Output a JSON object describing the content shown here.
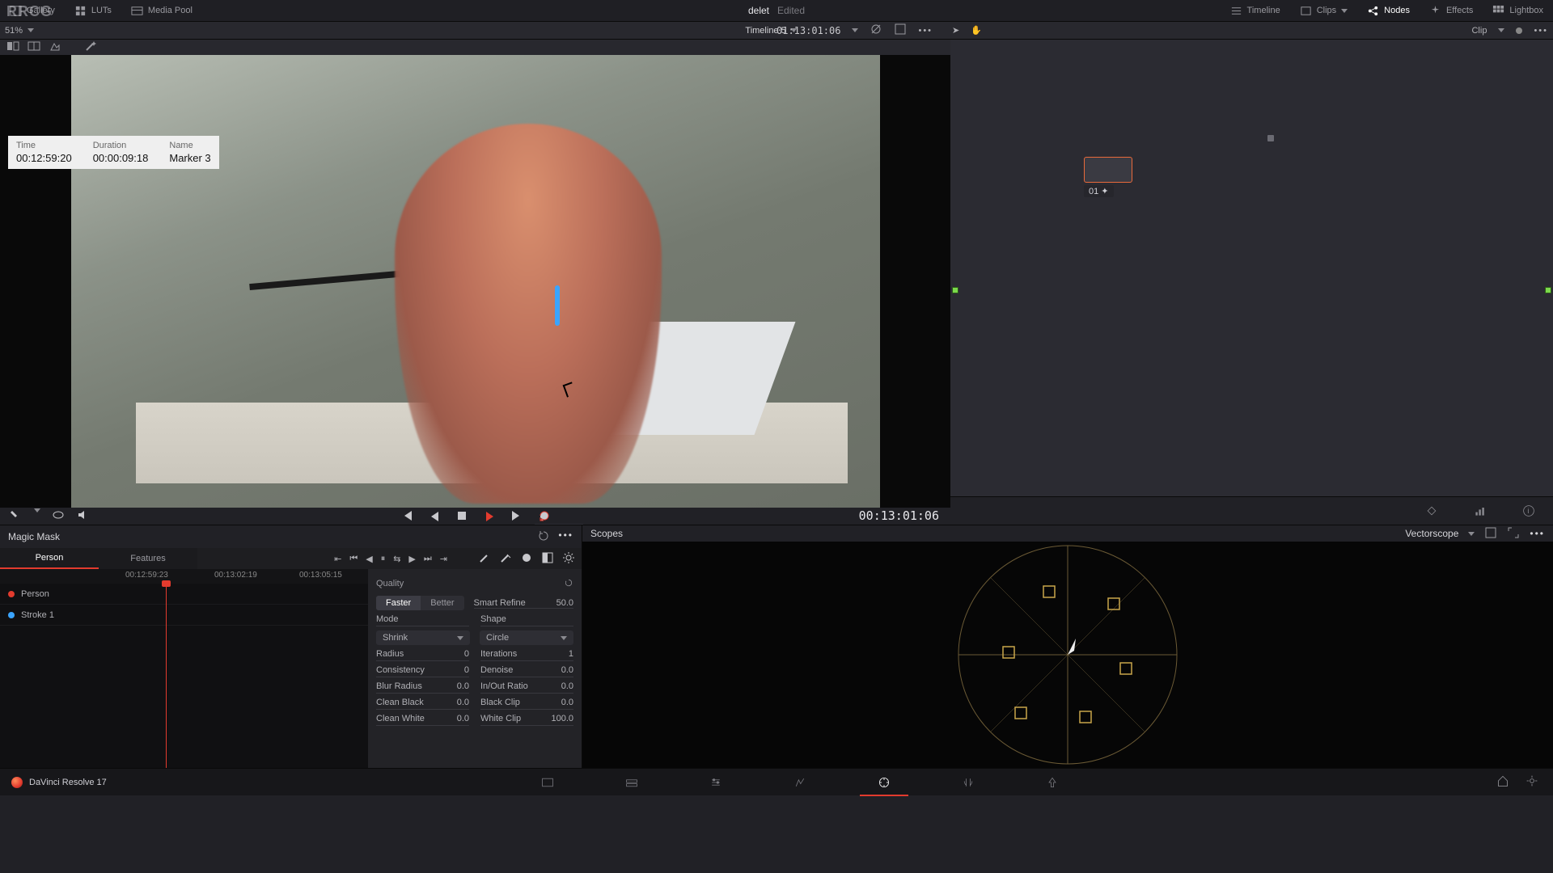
{
  "project": {
    "name": "delet",
    "status": "Edited"
  },
  "top_tabs": {
    "gallery": "Gallery",
    "luts": "LUTs",
    "media_pool": "Media Pool",
    "timeline": "Timeline",
    "clips": "Clips",
    "nodes": "Nodes",
    "effects": "Effects",
    "lightbox": "Lightbox"
  },
  "zoom": {
    "value": "51%"
  },
  "timeline_label": "Timeline 5",
  "viewer_tc_top": "01:13:01:06",
  "clip_mode": "Clip",
  "marker_tooltip": {
    "time_label": "Time",
    "time": "00:12:59:20",
    "duration_label": "Duration",
    "duration": "00:00:09:18",
    "name_label": "Name",
    "name": "Marker 3"
  },
  "transport_tc": "00:13:01:06",
  "node": {
    "label": "01"
  },
  "palette_names": [
    "camera-raw",
    "color-match",
    "color-wheels",
    "hdr-wheels",
    "rgb-mixer",
    "motion-effects",
    "curves",
    "warper",
    "qualifier",
    "window",
    "tracker",
    "magic-mask",
    "blur-sharpen",
    "key",
    "sizing",
    "3d"
  ],
  "magic_mask": {
    "title": "Magic Mask",
    "tabs": {
      "person": "Person",
      "features": "Features"
    },
    "rows": {
      "person": "Person",
      "stroke": "Stroke 1"
    },
    "ruler": [
      "00:12:59:23",
      "00:13:02:19",
      "00:13:05:15"
    ],
    "settings": {
      "quality_label": "Quality",
      "faster": "Faster",
      "better": "Better",
      "smart_refine_label": "Smart Refine",
      "smart_refine": "50.0",
      "mode_label": "Mode",
      "mode_value": "Shrink",
      "shape_label": "Shape",
      "shape_value": "Circle",
      "radius_label": "Radius",
      "radius": "0",
      "iterations_label": "Iterations",
      "iterations": "1",
      "consistency_label": "Consistency",
      "consistency": "0",
      "denoise_label": "Denoise",
      "denoise": "0.0",
      "blur_radius_label": "Blur Radius",
      "blur_radius": "0.0",
      "inout_label": "In/Out Ratio",
      "inout": "0.0",
      "clean_black_label": "Clean Black",
      "clean_black": "0.0",
      "black_clip_label": "Black Clip",
      "black_clip": "0.0",
      "clean_white_label": "Clean White",
      "clean_white": "0.0",
      "white_clip_label": "White Clip",
      "white_clip": "100.0"
    }
  },
  "scopes": {
    "title": "Scopes",
    "mode": "Vectorscope"
  },
  "app": {
    "name": "DaVinci Resolve 17"
  },
  "colors": {
    "accent": "#e33b2e",
    "mask": "#3aa4ff"
  }
}
